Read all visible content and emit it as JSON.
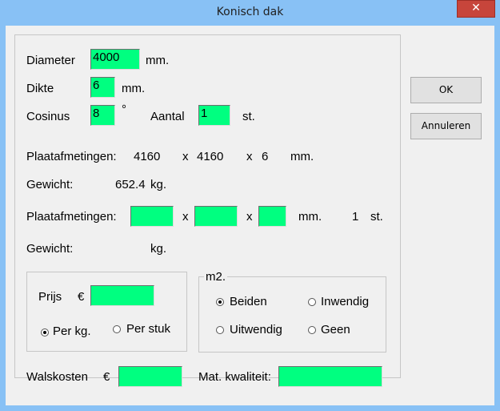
{
  "window": {
    "title": "Konisch dak",
    "close_glyph": "✕"
  },
  "form": {
    "diameter": {
      "label": "Diameter",
      "value": "4000",
      "unit": "mm."
    },
    "dikte": {
      "label": "Dikte",
      "value": "6",
      "unit": "mm."
    },
    "cosinus": {
      "label": "Cosinus",
      "value": "8",
      "unit": "°"
    },
    "aantal": {
      "label": "Aantal",
      "value": "1",
      "unit": "st."
    },
    "plaat1": {
      "label": "Plaatafmetingen:",
      "w": "4160",
      "x1": "x",
      "h": "4160",
      "x2": "x",
      "t": "6",
      "unit": "mm."
    },
    "gewicht1": {
      "label": "Gewicht:",
      "value": "652.4",
      "unit": "kg."
    },
    "plaat2": {
      "label": "Plaatafmetingen:",
      "x1": "x",
      "x2": "x",
      "unit": "mm.",
      "count": "1",
      "count_unit": "st.",
      "w": "",
      "h": "",
      "t": ""
    },
    "gewicht2": {
      "label": "Gewicht:",
      "value": "",
      "unit": "kg."
    },
    "prijs": {
      "label": "Prijs",
      "currency": "€",
      "value": "",
      "per_kg": "Per kg.",
      "per_stuk": "Per stuk",
      "selected": "per_kg"
    },
    "m2": {
      "legend": "m2.",
      "beiden": "Beiden",
      "inwendig": "Inwendig",
      "uitwendig": "Uitwendig",
      "geen": "Geen",
      "selected": "beiden"
    },
    "walskosten": {
      "label": "Walskosten",
      "currency": "€",
      "value": ""
    },
    "mat_kwaliteit": {
      "label": "Mat. kwaliteit:",
      "value": ""
    }
  },
  "buttons": {
    "ok": "OK",
    "annuleren": "Annuleren"
  }
}
